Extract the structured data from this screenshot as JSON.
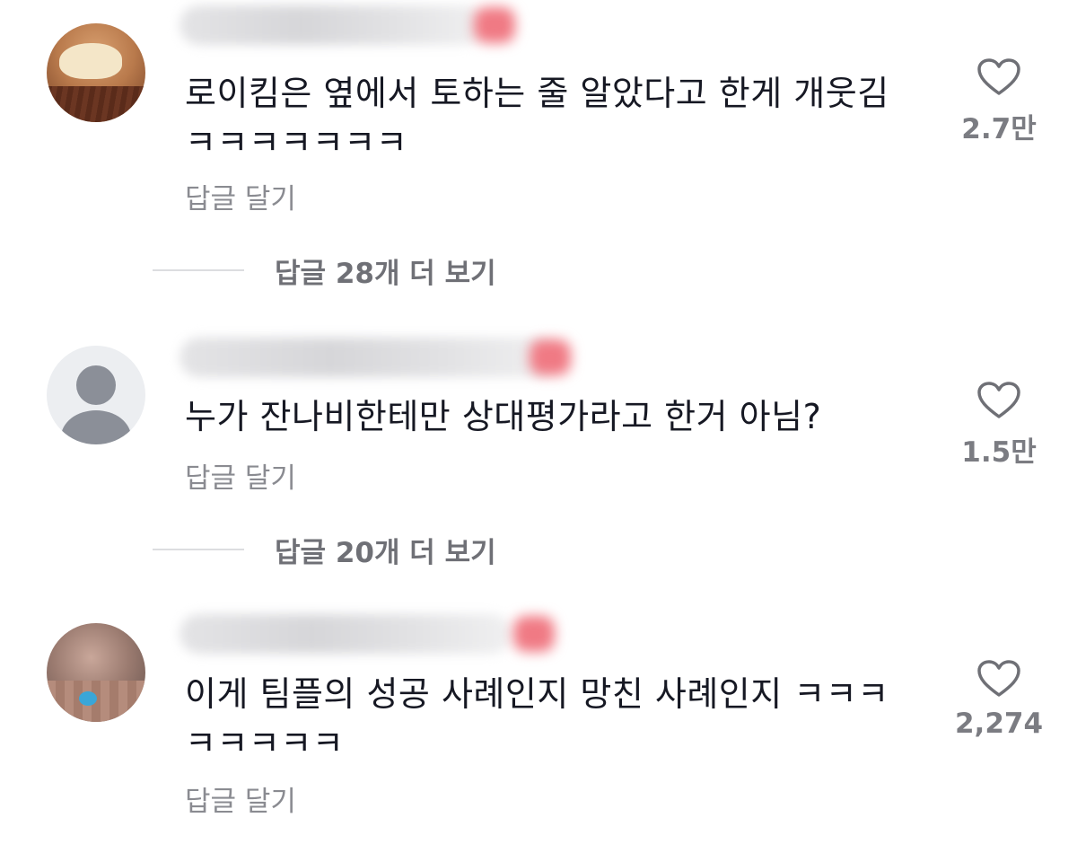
{
  "comments": [
    {
      "text": "로이킴은 옆에서 토하는 줄 알았다고 한게 개웃김 ㅋㅋㅋㅋㅋㅋㅋ",
      "reply_label": "답글 달기",
      "likes": "2.7만",
      "like_icon": "heart-outline-icon",
      "more_replies": "답글 28개 더 보기"
    },
    {
      "text": "누가 잔나비한테만 상대평가라고 한거 아님?",
      "reply_label": "답글 달기",
      "likes": "1.5만",
      "like_icon": "heart-outline-icon",
      "more_replies": "답글 20개 더 보기"
    },
    {
      "text": "이게 팀플의 성공 사례인지 망친 사례인지 ㅋㅋㅋ ㅋㅋㅋㅋㅋ",
      "reply_label": "답글 달기",
      "likes": "2,274",
      "like_icon": "heart-outline-icon"
    }
  ],
  "colors": {
    "text": "#161823",
    "secondary": "#8a8b91",
    "like_count": "#7b7c82",
    "blurred_badge": "#f07a84"
  }
}
